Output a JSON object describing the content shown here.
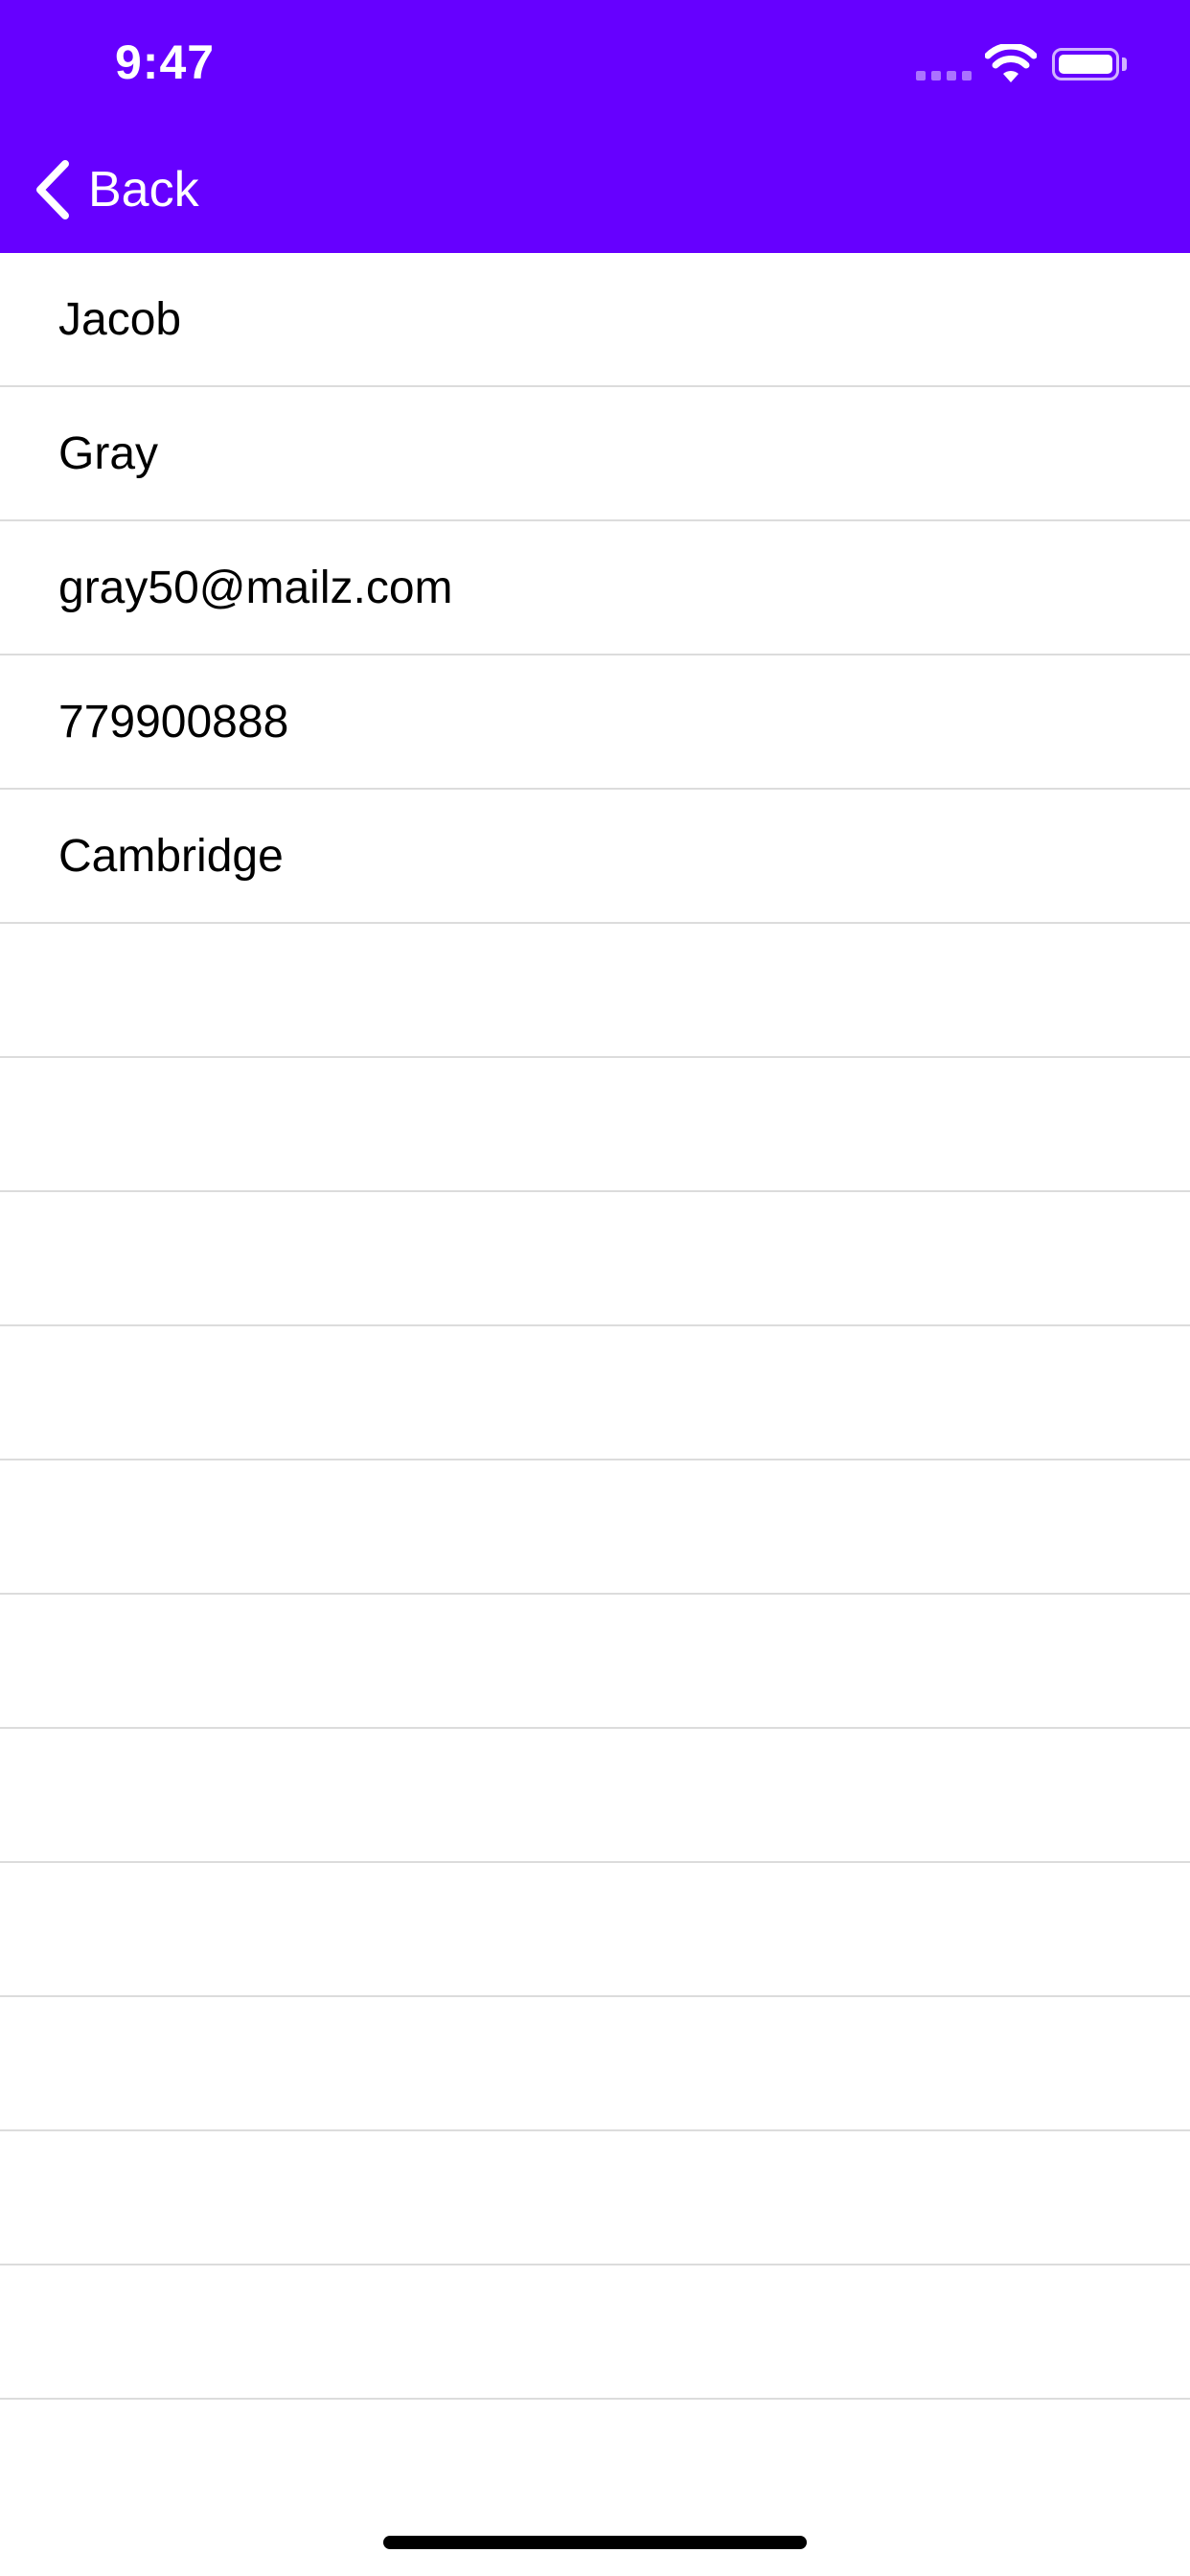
{
  "status_bar": {
    "time": "9:47"
  },
  "nav": {
    "back_label": "Back",
    "background_color": "#6600ff"
  },
  "details": {
    "rows": [
      {
        "value": "Jacob"
      },
      {
        "value": "Gray"
      },
      {
        "value": "gray50@mailz.com"
      },
      {
        "value": "779900888"
      },
      {
        "value": "Cambridge"
      },
      {
        "value": ""
      },
      {
        "value": ""
      },
      {
        "value": ""
      },
      {
        "value": ""
      },
      {
        "value": ""
      },
      {
        "value": ""
      },
      {
        "value": ""
      },
      {
        "value": ""
      },
      {
        "value": ""
      },
      {
        "value": ""
      },
      {
        "value": ""
      },
      {
        "value": ""
      }
    ]
  }
}
